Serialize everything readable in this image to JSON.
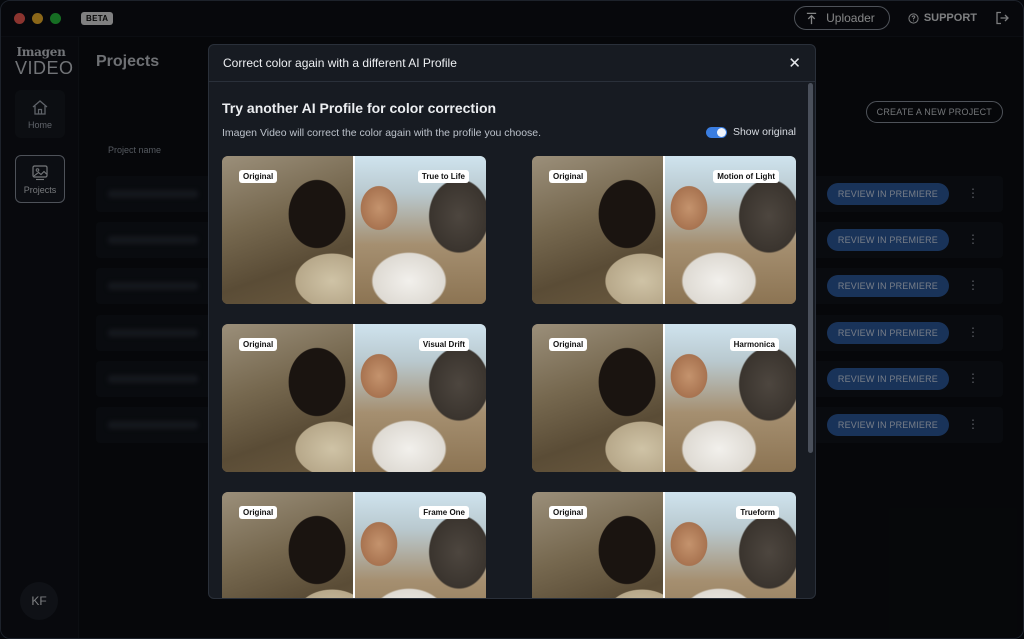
{
  "titlebar": {
    "beta_label": "BETA",
    "uploader_label": "Uploader",
    "support_label": "SUPPORT"
  },
  "sidebar": {
    "logo_top": "Imagen",
    "logo_bottom": "VIDEO",
    "items": [
      {
        "label": "Home",
        "icon": "home-icon"
      },
      {
        "label": "Projects",
        "icon": "image-icon"
      }
    ],
    "avatar_initials": "KF"
  },
  "main": {
    "title": "Projects",
    "create_button": "CREATE A NEW PROJECT",
    "column_header": "Project name",
    "rows": [
      {
        "review_label": "REVIEW IN PREMIERE"
      },
      {
        "review_label": "REVIEW IN PREMIERE"
      },
      {
        "review_label": "REVIEW IN PREMIERE"
      },
      {
        "review_label": "REVIEW IN PREMIERE"
      },
      {
        "review_label": "REVIEW IN PREMIERE"
      },
      {
        "review_label": "REVIEW IN PREMIERE"
      }
    ]
  },
  "modal": {
    "title": "Correct color again with a different AI Profile",
    "subtitle": "Try another AI Profile for color correction",
    "description": "Imagen Video will correct the color again with the profile you choose.",
    "toggle_label": "Show original",
    "toggle_on": true,
    "original_tag": "Original",
    "profiles": [
      {
        "name": "True to Life"
      },
      {
        "name": "Motion of Light"
      },
      {
        "name": "Visual Drift"
      },
      {
        "name": "Harmonica"
      },
      {
        "name": "Frame One"
      },
      {
        "name": "Trueform"
      }
    ]
  },
  "colors": {
    "accent": "#3a7de0",
    "review_button": "#2f5da3",
    "background": "#0b0e13",
    "modal": "#171b22"
  }
}
